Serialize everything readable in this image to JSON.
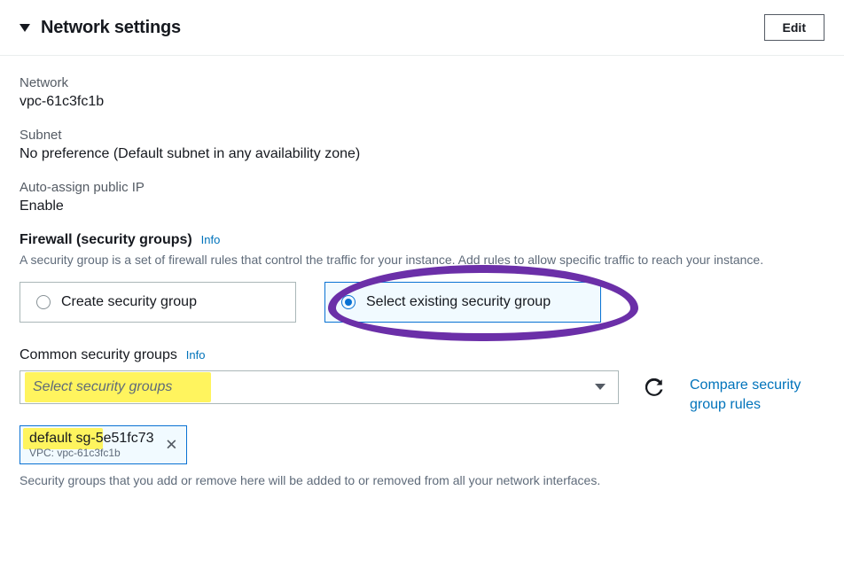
{
  "header": {
    "title": "Network settings",
    "edit_label": "Edit"
  },
  "fields": {
    "network_label": "Network",
    "network_value": "vpc-61c3fc1b",
    "subnet_label": "Subnet",
    "subnet_value": "No preference (Default subnet in any availability zone)",
    "autoip_label": "Auto-assign public IP",
    "autoip_value": "Enable"
  },
  "firewall": {
    "label": "Firewall (security groups)",
    "info": "Info",
    "desc": "A security group is a set of firewall rules that control the traffic for your instance. Add rules to allow specific traffic to reach your instance.",
    "option_create": "Create security group",
    "option_select": "Select existing security group"
  },
  "common_sg": {
    "label": "Common security groups",
    "info": "Info",
    "placeholder": "Select security groups",
    "compare_link": "Compare security group rules",
    "chip_main": "default  sg-5e51fc73",
    "chip_sub": "VPC: vpc-61c3fc1b",
    "helper": "Security groups that you add or remove here will be added to or removed from all your network interfaces."
  }
}
